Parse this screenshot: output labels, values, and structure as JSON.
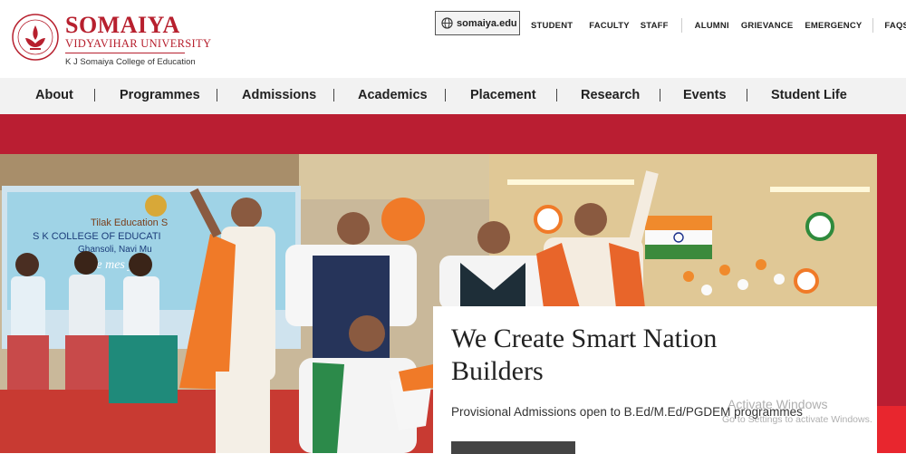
{
  "header": {
    "brand_name": "SOMAIYA",
    "university": "VIDYAVIHAR UNIVERSITY",
    "college": "K J Somaiya College of Education",
    "logo_icon": "somaiya-lotus-seal-icon",
    "site_label": "somaiya.edu",
    "site_icon": "globe-icon",
    "links": [
      "STUDENT",
      "FACULTY",
      "STAFF",
      "ALUMNI",
      "GRIEVANCE",
      "EMERGENCY",
      "FAQS"
    ]
  },
  "nav": {
    "items": [
      "About",
      "Programmes",
      "Admissions",
      "Academics",
      "Placement",
      "Research",
      "Events",
      "Student Life"
    ]
  },
  "hero": {
    "heading": "We Create Smart Nation Builders",
    "subtext": "Provisional Admissions open to B.Ed/M.Ed/PGDEM programmes",
    "photo_banner_line1": "Tilak Education S",
    "photo_banner_line2": "S K COLLEGE OF EDUCATI",
    "photo_banner_line3": "Ghansoli, Navi Mu",
    "photo_banner_line4": "We         mes y"
  },
  "watermark": {
    "line1": "Activate Windows",
    "line2": "Go to Settings to activate Windows."
  },
  "colors": {
    "brand_red": "#b7202e",
    "band_red": "#ba1e32",
    "nav_bg": "#f2f2f2"
  }
}
